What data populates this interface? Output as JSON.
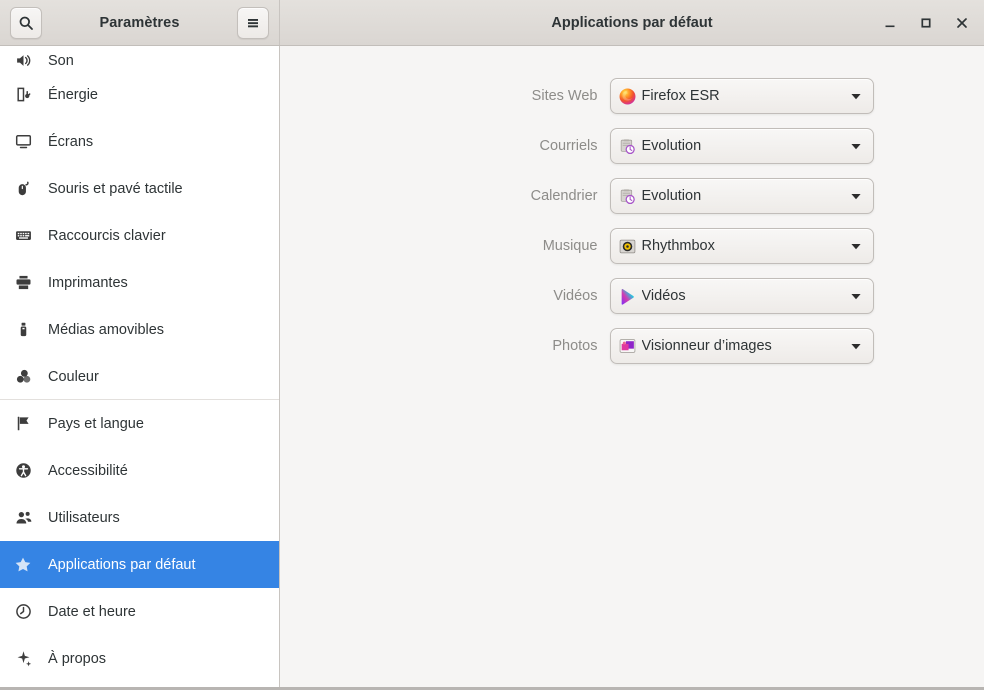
{
  "window": {
    "sidebar_title": "Paramètres",
    "content_title": "Applications par défaut",
    "search_icon": "search-icon",
    "menu_icon": "hamburger-menu-icon",
    "controls": {
      "minimize": "minimize-icon",
      "maximize": "maximize-icon",
      "close": "close-icon"
    }
  },
  "sidebar": {
    "items": [
      {
        "label": "Son",
        "icon": "speaker-icon",
        "selected": false,
        "clipped": true,
        "separator_after": false
      },
      {
        "label": "Énergie",
        "icon": "battery-icon",
        "selected": false,
        "clipped": false,
        "separator_after": false
      },
      {
        "label": "Écrans",
        "icon": "display-icon",
        "selected": false,
        "clipped": false,
        "separator_after": false
      },
      {
        "label": "Souris et pavé tactile",
        "icon": "mouse-icon",
        "selected": false,
        "clipped": false,
        "separator_after": false
      },
      {
        "label": "Raccourcis clavier",
        "icon": "keyboard-icon",
        "selected": false,
        "clipped": false,
        "separator_after": false
      },
      {
        "label": "Imprimantes",
        "icon": "printer-icon",
        "selected": false,
        "clipped": false,
        "separator_after": false
      },
      {
        "label": "Médias amovibles",
        "icon": "usb-drive-icon",
        "selected": false,
        "clipped": false,
        "separator_after": false
      },
      {
        "label": "Couleur",
        "icon": "color-wheel-icon",
        "selected": false,
        "clipped": false,
        "separator_after": true
      },
      {
        "label": "Pays et langue",
        "icon": "flag-icon",
        "selected": false,
        "clipped": false,
        "separator_after": false
      },
      {
        "label": "Accessibilité",
        "icon": "accessibility-icon",
        "selected": false,
        "clipped": false,
        "separator_after": false
      },
      {
        "label": "Utilisateurs",
        "icon": "users-icon",
        "selected": false,
        "clipped": false,
        "separator_after": false
      },
      {
        "label": "Applications par défaut",
        "icon": "star-icon",
        "selected": true,
        "clipped": false,
        "separator_after": false
      },
      {
        "label": "Date et heure",
        "icon": "clock-icon",
        "selected": false,
        "clipped": false,
        "separator_after": false
      },
      {
        "label": "À propos",
        "icon": "sparkle-icon",
        "selected": false,
        "clipped": false,
        "separator_after": false
      }
    ]
  },
  "main": {
    "rows": [
      {
        "label": "Sites Web",
        "value": "Firefox ESR",
        "app_icon": "firefox-icon"
      },
      {
        "label": "Courriels",
        "value": "Evolution",
        "app_icon": "evolution-mail-icon"
      },
      {
        "label": "Calendrier",
        "value": "Evolution",
        "app_icon": "evolution-calendar-icon"
      },
      {
        "label": "Musique",
        "value": "Rhythmbox",
        "app_icon": "rhythmbox-icon"
      },
      {
        "label": "Vidéos",
        "value": "Vidéos",
        "app_icon": "totem-videos-icon"
      },
      {
        "label": "Photos",
        "value": "Visionneur d’images",
        "app_icon": "image-viewer-icon"
      }
    ],
    "dropdown_arrow_icon": "chevron-down-icon"
  },
  "colors": {
    "accent": "#3584e4",
    "sidebar_bg": "#ffffff",
    "content_bg": "#f6f5f4",
    "headerbar_bg": "#dad6d2",
    "text": "#2e3436",
    "dim_text": "#8d8c89"
  }
}
